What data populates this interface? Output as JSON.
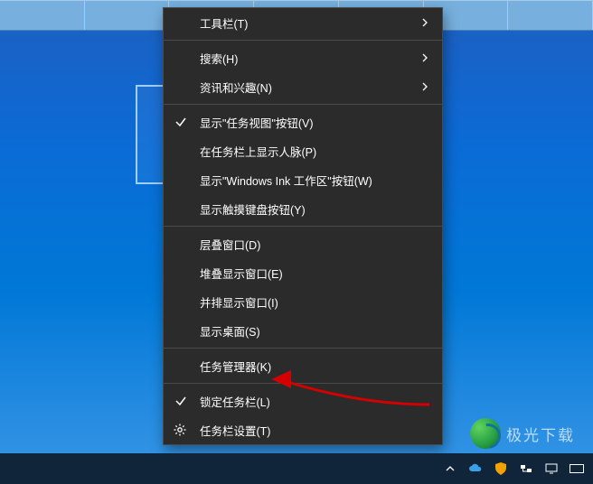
{
  "top_tabs": [
    "",
    "",
    "",
    "",
    "",
    "",
    ""
  ],
  "context_menu": {
    "groups": [
      [
        {
          "label": "工具栏(T)",
          "submenu": true,
          "checked": false,
          "icon": null
        }
      ],
      [
        {
          "label": "搜索(H)",
          "submenu": true,
          "checked": false,
          "icon": null
        },
        {
          "label": "资讯和兴趣(N)",
          "submenu": true,
          "checked": false,
          "icon": null
        }
      ],
      [
        {
          "label": "显示\"任务视图\"按钮(V)",
          "submenu": false,
          "checked": true,
          "icon": null
        },
        {
          "label": "在任务栏上显示人脉(P)",
          "submenu": false,
          "checked": false,
          "icon": null
        },
        {
          "label": "显示\"Windows Ink 工作区\"按钮(W)",
          "submenu": false,
          "checked": false,
          "icon": null
        },
        {
          "label": "显示触摸键盘按钮(Y)",
          "submenu": false,
          "checked": false,
          "icon": null
        }
      ],
      [
        {
          "label": "层叠窗口(D)",
          "submenu": false,
          "checked": false,
          "icon": null
        },
        {
          "label": "堆叠显示窗口(E)",
          "submenu": false,
          "checked": false,
          "icon": null
        },
        {
          "label": "并排显示窗口(I)",
          "submenu": false,
          "checked": false,
          "icon": null
        },
        {
          "label": "显示桌面(S)",
          "submenu": false,
          "checked": false,
          "icon": null
        }
      ],
      [
        {
          "label": "任务管理器(K)",
          "submenu": false,
          "checked": false,
          "icon": null
        }
      ],
      [
        {
          "label": "锁定任务栏(L)",
          "submenu": false,
          "checked": true,
          "icon": null
        },
        {
          "label": "任务栏设置(T)",
          "submenu": false,
          "checked": false,
          "icon": "gear"
        }
      ]
    ]
  },
  "tray": {
    "items": [
      {
        "name": "chevron-up-icon"
      },
      {
        "name": "cloud-icon"
      },
      {
        "name": "shield-icon"
      },
      {
        "name": "network-icon"
      },
      {
        "name": "monitor-icon"
      },
      {
        "name": "keyboard-icon"
      }
    ]
  },
  "watermark": {
    "text": "极光下载"
  },
  "colors": {
    "menu_bg": "#2b2b2b",
    "menu_fg": "#ffffff",
    "desktop": "#0078d7",
    "arrow": "#d40000"
  }
}
